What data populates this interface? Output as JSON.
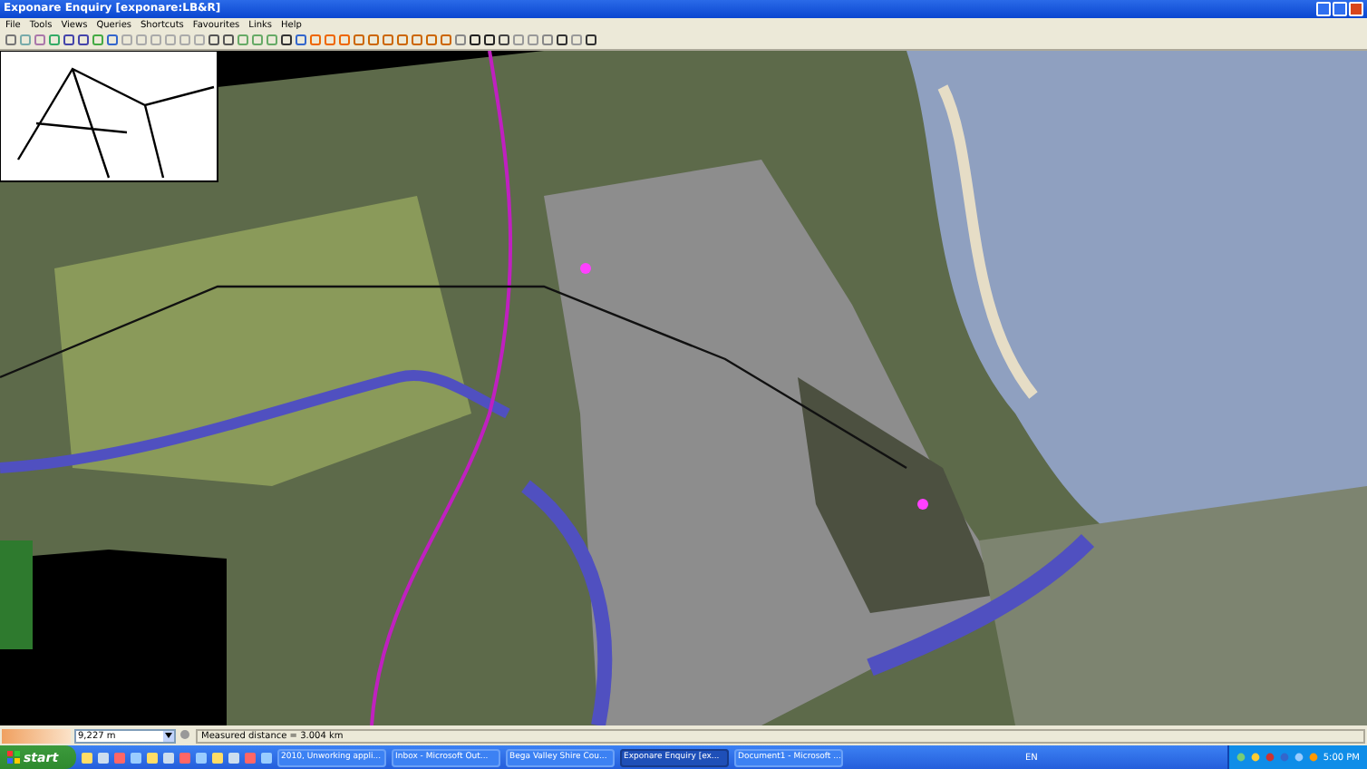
{
  "window": {
    "title": "Exponare Enquiry [exponare:LB&R]"
  },
  "menu": [
    "File",
    "Tools",
    "Views",
    "Queries",
    "Shortcuts",
    "Favourites",
    "Links",
    "Help"
  ],
  "status_bar": {
    "scale": "9,227 m",
    "message": "Measured distance = 3.004 km"
  },
  "taskbar": {
    "start": "start",
    "tasks": [
      {
        "label": "2010, Unworking appli...",
        "selected": false
      },
      {
        "label": "Inbox - Microsoft Out...",
        "selected": false
      },
      {
        "label": "Bega Valley Shire Cou...",
        "selected": false
      },
      {
        "label": "Exponare Enquiry [ex...",
        "selected": true
      },
      {
        "label": "Document1 - Microsoft ...",
        "selected": false
      }
    ],
    "language": "EN",
    "clock": "5:00 PM"
  }
}
